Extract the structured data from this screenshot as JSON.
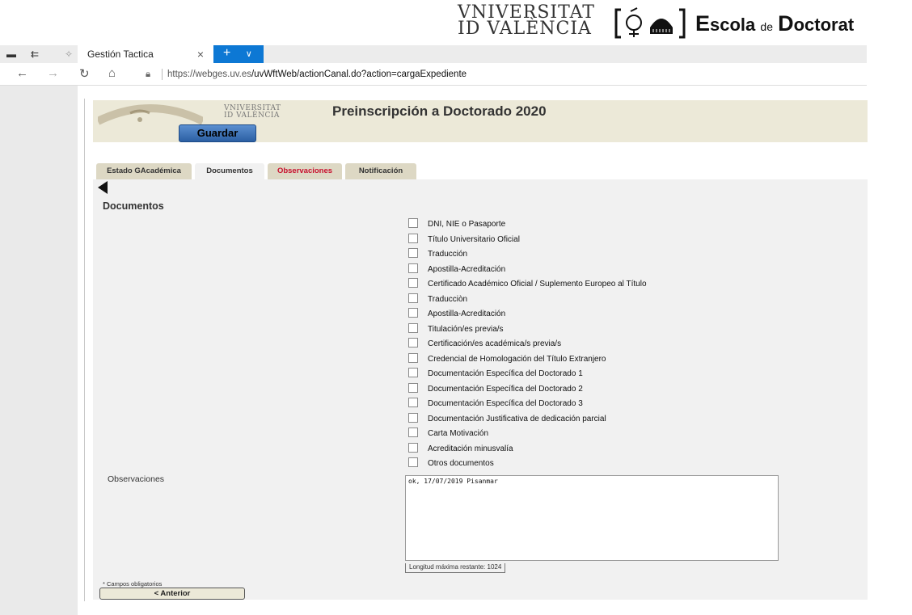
{
  "branding": {
    "univ_line1": "VNIVERSITAT",
    "univ_line2": "ID VALÈNCIA",
    "school": {
      "first": "E",
      "rest": "scola",
      "de": "de",
      "first2": "D",
      "rest2": "octorat"
    }
  },
  "browser": {
    "tab_title": "Gestión Tactica",
    "tab_close": "×",
    "new_tab": "+",
    "tab_menu": "∨",
    "url_host": "https://webges.uv.es",
    "url_path": "/uvWftWeb/actionCanal.do?action=cargaExpediente",
    "nav": {
      "back": "←",
      "forward": "→",
      "refresh": "↻",
      "home": "⌂"
    }
  },
  "app": {
    "header_univ_l1": "VNIVERSITAT",
    "header_univ_l2": "ID VALÈNCIA",
    "title": "Preinscripción a Doctorado 2020",
    "save_label": "Guardar",
    "tabs": [
      {
        "label": "Estado GAcadémica"
      },
      {
        "label": "Documentos"
      },
      {
        "label": "Observaciones"
      },
      {
        "label": "Notificación"
      }
    ],
    "section_title": "Documentos",
    "documents": [
      "DNI, NIE o Pasaporte",
      "Título Universitario Oficial",
      "Traducción",
      "Apostilla-Acreditación",
      "Certificado Académico Oficial / Suplemento Europeo al Título",
      "Traducciòn",
      "Apostilla-Acreditación",
      "Titulación/es previa/s",
      "Certificación/es académica/s previa/s",
      "Credencial de Homologación del Título Extranjero",
      "Documentación Específica del Doctorado 1",
      "Documentación Específica del Doctorado 2",
      "Documentación Específica del Doctorado 3",
      "Documentación Justificativa de dedicación parcial",
      "Carta Motivación",
      "Acreditación minusvalía",
      "Otros documentos"
    ],
    "observations_label": "Observaciones",
    "observations_value": "ok, 17/07/2019 Pisanmar",
    "max_length": "Longitud máxima restante: 1024",
    "required_note": "* Campos obligatorios",
    "prev_label": "< Anterior"
  },
  "colors": {
    "accent_blue": "#0d78d4",
    "header_beige": "#ece9d8",
    "tab_red": "#c8102e",
    "button_blue": "#2b5fa3"
  }
}
